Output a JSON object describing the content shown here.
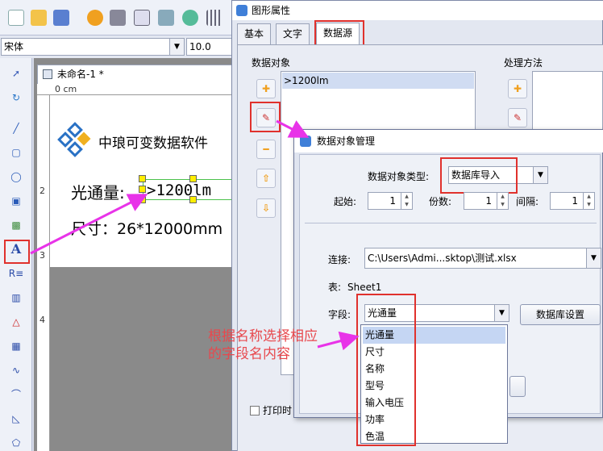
{
  "toolbar": {
    "font_name": "宋体",
    "font_size": "10.0"
  },
  "document": {
    "tab_title": "未命名-1 *",
    "ruler_label": "0 cm",
    "ruler_nums": [
      "2",
      "3",
      "4"
    ],
    "logo_text": "中琅可变数据软件",
    "line1_label": "光通量:",
    "line1_value": ">1200lm",
    "line2_text": "尺寸：26*12000mm"
  },
  "props_dialog": {
    "title": "图形属性",
    "tabs": [
      "基本",
      "文字",
      "数据源"
    ],
    "section_data_objects": "数据对象",
    "section_processing": "处理方法",
    "data_object_item": ">1200lm",
    "print_label": "打印时"
  },
  "dom_dialog": {
    "title": "数据对象管理",
    "type_label": "数据对象类型:",
    "type_value": "数据库导入",
    "start_label": "起始:",
    "start_value": "1",
    "copies_label": "份数:",
    "copies_value": "1",
    "interval_label": "间隔:",
    "interval_value": "1",
    "connect_label": "连接:",
    "connect_value": "C:\\Users\\Admi...sktop\\测试.xlsx",
    "table_label": "表:",
    "table_value": "Sheet1",
    "field_label": "字段:",
    "field_value": "光通量",
    "db_settings_button": "数据库设置",
    "field_options": [
      "光通量",
      "尺寸",
      "名称",
      "型号",
      "输入电压",
      "功率",
      "色温"
    ]
  },
  "annotation": "根据名称选择相应的字段名内容",
  "colors": {
    "highlight": "#e0312d",
    "arrow": "#e833e8",
    "annotation": "#e8484d",
    "selection": "#c5d6f3"
  }
}
